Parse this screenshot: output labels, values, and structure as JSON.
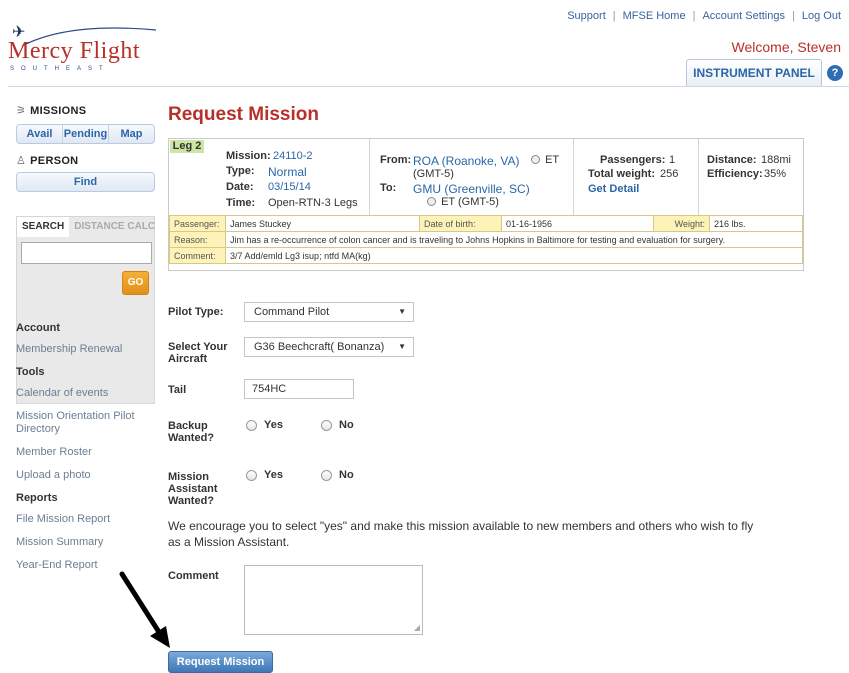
{
  "brand": {
    "name": "Mercy Flight",
    "tagline": "SOUTHEAST"
  },
  "topnav": {
    "support": "Support",
    "home": "MFSE Home",
    "settings": "Account Settings",
    "logout": "Log Out"
  },
  "welcome": "Welcome, Steven",
  "instrument_panel": "INSTRUMENT PANEL",
  "help": "?",
  "sidebar": {
    "missions_head": "MISSIONS",
    "missions_tabs": [
      "Avail",
      "Pending",
      "Map"
    ],
    "person_head": "PERSON",
    "person_btn": "Find",
    "search_tab": "SEARCH",
    "distance_tab": "DISTANCE CALC",
    "search_placeholder": "",
    "go": "GO",
    "menu": {
      "account": "Account",
      "membership": "Membership Renewal",
      "tools": "Tools",
      "calendar": "Calendar of events",
      "pilot_directory": "Mission Orientation Pilot Directory",
      "roster": "Member Roster",
      "upload": "Upload a photo",
      "reports": "Reports",
      "file_report": "File Mission Report",
      "summary": "Mission Summary",
      "year_end": "Year-End Report"
    }
  },
  "page_title": "Request Mission",
  "mission": {
    "leg": "Leg 2",
    "mission_label": "Mission:",
    "mission_value": "24110-2",
    "type_label": "Type:",
    "type_value": "Normal",
    "date_label": "Date:",
    "date_value": "03/15/14",
    "time_label": "Time:",
    "time_value": "Open-RTN-3 Legs",
    "from_label": "From:",
    "from_value": "ROA (Roanoke, VA)",
    "from_tz": "ET",
    "from_gmt": "(GMT-5)",
    "to_label": "To:",
    "to_value": "GMU (Greenville, SC)",
    "to_tz": "ET (GMT-5)",
    "passengers_label": "Passengers:",
    "passengers_value": "1",
    "weight_label": "Total weight:",
    "weight_value": "256",
    "get_detail": "Get Detail",
    "distance_label": "Distance:",
    "distance_value": "188mi",
    "efficiency_label": "Efficiency:",
    "efficiency_value": "35%"
  },
  "passenger": {
    "passenger_label": "Passenger:",
    "passenger_value": "James Stuckey",
    "dob_label": "Date of birth:",
    "dob_value": "01-16-1956",
    "weight_label": "Weight:",
    "weight_value": "216 lbs.",
    "reason_label": "Reason:",
    "reason_value": "Jim has a re-occurrence of colon cancer and is traveling to Johns Hopkins in Baltimore for testing and evaluation for surgery.",
    "comment_label": "Comment:",
    "comment_value": "3/7 Add/emld Lg3 isup; ntfd MA(kg)"
  },
  "form": {
    "pilot_type_label": "Pilot Type:",
    "pilot_type_value": "Command Pilot",
    "aircraft_label": "Select Your Aircraft",
    "aircraft_value": "G36 Beechcraft( Bonanza)",
    "tail_label": "Tail",
    "tail_value": "754HC",
    "backup_label": "Backup Wanted?",
    "assistant_label": "Mission Assistant Wanted?",
    "yes": "Yes",
    "no": "No",
    "encourage": "We encourage you to select \"yes\" and make this mission available to new members and others who wish to fly as a Mission Assistant.",
    "comment_label": "Comment",
    "comment_value": "",
    "submit": "Request Mission"
  }
}
